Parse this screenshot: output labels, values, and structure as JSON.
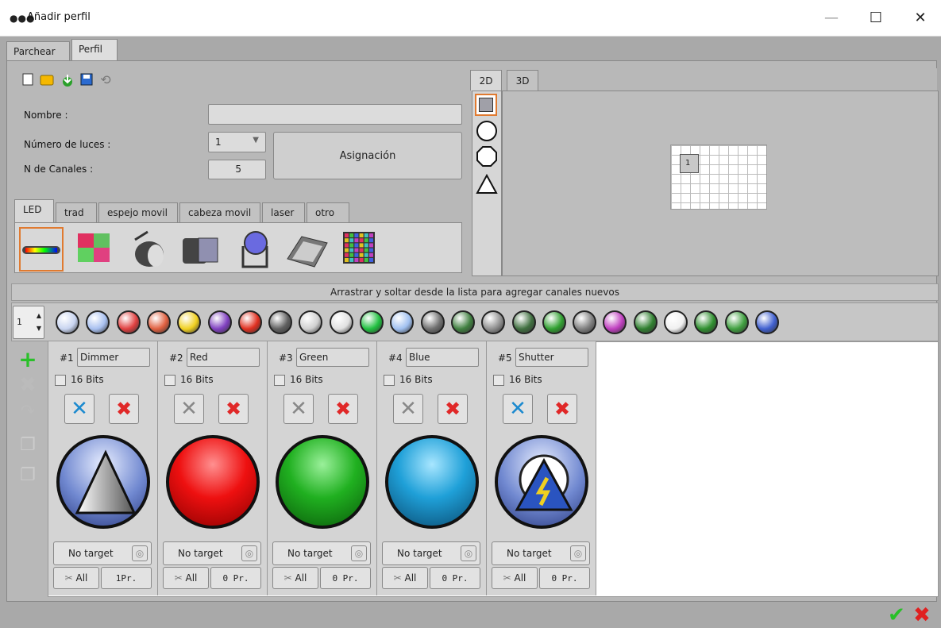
{
  "window": {
    "title": "Añadir perfil",
    "minimize": "—",
    "maximize": "☐",
    "close": "✕"
  },
  "main_tabs": [
    {
      "label": "Parchear"
    },
    {
      "label": "Perfil"
    }
  ],
  "toolbar": {
    "icons": [
      "new-file-icon",
      "open-folder-icon",
      "download-icon",
      "save-icon",
      "refresh-icon"
    ]
  },
  "form": {
    "name_label": "Nombre :",
    "name_value": "",
    "lights_label": "Número de luces :",
    "lights_value": "1",
    "channels_label": "N de Canales  :",
    "channels_value": "5",
    "assign_button": "Asignación"
  },
  "profile_tabs": [
    {
      "label": "LED"
    },
    {
      "label": "trad"
    },
    {
      "label": "espejo movil"
    },
    {
      "label": "cabeza movil"
    },
    {
      "label": "laser"
    },
    {
      "label": "otro"
    }
  ],
  "fixture_types": [
    "led-bar-icon",
    "led-panel-icon",
    "par-can-icon",
    "flood-light-icon",
    "moving-head-icon",
    "led-wash-panel-icon",
    "led-matrix-icon"
  ],
  "view_tabs": [
    {
      "label": "2D"
    },
    {
      "label": "3D"
    }
  ],
  "shapes": [
    "square-shape-icon",
    "circle-shape-icon",
    "octagon-shape-icon",
    "triangle-shape-icon"
  ],
  "grid": {
    "cell_label": "1"
  },
  "drag_bar": "Arrastrar y soltar desde la lista para agregar canales nuevos",
  "spinner_value": "1",
  "channel_icons": [
    {
      "name": "intensity-icon",
      "color": "#c8d4f0"
    },
    {
      "name": "master-intensity-icon",
      "color": "#a8c0f0"
    },
    {
      "name": "rgb-icon",
      "color": "#e04040"
    },
    {
      "name": "rgbw-icon",
      "color": "#e06040"
    },
    {
      "name": "cmy-icon",
      "color": "#f0d020"
    },
    {
      "name": "color-wheel-icon",
      "color": "#8040c0"
    },
    {
      "name": "color-temp-icon",
      "color": "#e03020"
    },
    {
      "name": "speed-icon",
      "color": "#606060"
    },
    {
      "name": "pan-tilt-icon",
      "color": "#d0d0d0"
    },
    {
      "name": "iris-icon",
      "color": "#e0e0e0"
    },
    {
      "name": "color-mix-icon",
      "color": "#20c040"
    },
    {
      "name": "zoom-icon",
      "color": "#a0c0f0"
    },
    {
      "name": "gobo-icon",
      "color": "#707070"
    },
    {
      "name": "gobo-rotate-icon",
      "color": "#408040"
    },
    {
      "name": "gobo-wheel-icon",
      "color": "#909090"
    },
    {
      "name": "prism-icon",
      "color": "#407040"
    },
    {
      "name": "frost-icon",
      "color": "#30a030"
    },
    {
      "name": "effect-icon",
      "color": "#808080"
    },
    {
      "name": "macro-icon",
      "color": "#c040c0"
    },
    {
      "name": "rotation-icon",
      "color": "#308030"
    },
    {
      "name": "pie-icon",
      "color": "#f0f0f0"
    },
    {
      "name": "reset-icon",
      "color": "#309030"
    },
    {
      "name": "hash-icon",
      "color": "#40a040"
    },
    {
      "name": "help-icon",
      "color": "#4060d0"
    }
  ],
  "channels": [
    {
      "num": "#1",
      "name": "Dimmer",
      "bits": "16 Bits",
      "target": "No target",
      "all": "All",
      "pr": "1Pr.",
      "color": "#6f86d0",
      "kind": "dimmer",
      "active": true
    },
    {
      "num": "#2",
      "name": "Red",
      "bits": "16 Bits",
      "target": "No target",
      "all": "All",
      "pr": "0 Pr.",
      "color": "#e01010",
      "kind": "red",
      "active": false
    },
    {
      "num": "#3",
      "name": "Green",
      "bits": "16 Bits",
      "target": "No target",
      "all": "All",
      "pr": "0 Pr.",
      "color": "#18a818",
      "kind": "green",
      "active": false
    },
    {
      "num": "#4",
      "name": "Blue",
      "bits": "16 Bits",
      "target": "No target",
      "all": "All",
      "pr": "0 Pr.",
      "color": "#1a9fd8",
      "kind": "blue",
      "active": false
    },
    {
      "num": "#5",
      "name": "Shutter",
      "bits": "16 Bits",
      "target": "No target",
      "all": "All",
      "pr": "0 Pr.",
      "color": "#6f86d0",
      "kind": "shutter",
      "active": true
    }
  ],
  "side_tools": [
    "add-channel-icon",
    "remove-channel-icon",
    "undo-icon",
    "copy-icon",
    "paste-icon"
  ],
  "dialog": {
    "ok": "✔",
    "cancel": "✖"
  }
}
